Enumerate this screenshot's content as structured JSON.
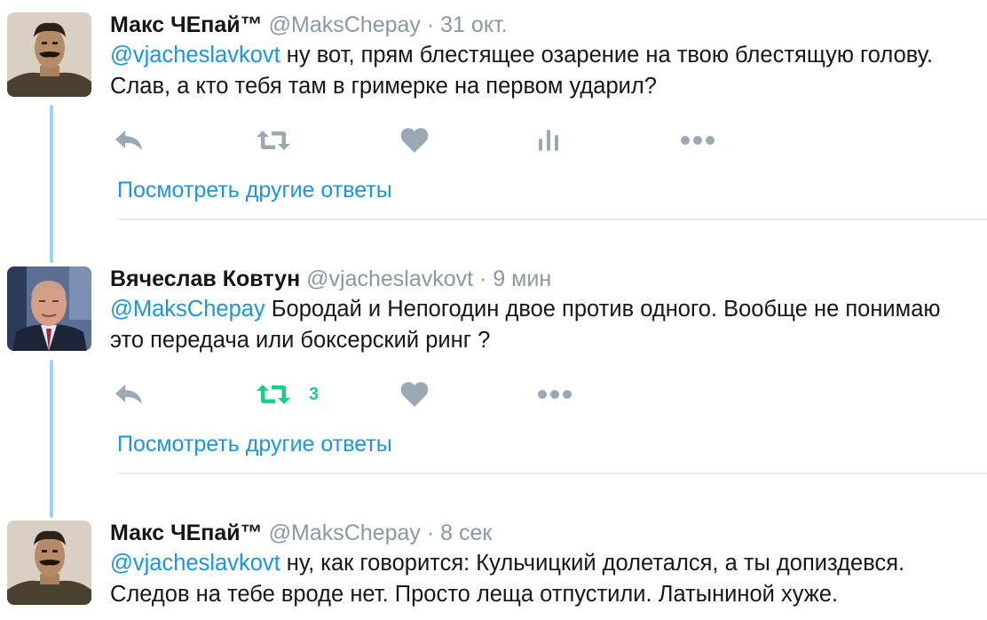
{
  "colors": {
    "link": "#1b95e0",
    "muted": "#8899a6",
    "retweeted": "#19cf86",
    "thread_line": "#9fd0f5"
  },
  "tweets": [
    {
      "name": "Макс ЧЕпай™",
      "handle": "@MaksChepay",
      "separator": "·",
      "time": "31 окт.",
      "mention": "@vjacheslavkovt",
      "text": " ну вот, прям блестящее озарение на твою блестящую голову. Слав, а кто тебя там в гримерке на первом ударил?",
      "actions": [
        "reply-icon",
        "retweet-icon",
        "like-icon",
        "analytics-icon",
        "more-icon"
      ],
      "more_replies": "Посмотреть другие ответы"
    },
    {
      "name": "Вячеслав Ковтун",
      "handle": "@vjacheslavkovt",
      "separator": "·",
      "time": "9 мин",
      "mention": "@MaksChepay",
      "text": " Бородай и Непогодин двое против одного. Вообще не понимаю это передача или боксерский ринг ?",
      "retweet_count": "3",
      "actions": [
        "reply-icon",
        "retweet-icon",
        "like-icon",
        "more-icon"
      ],
      "more_replies": "Посмотреть другие ответы"
    },
    {
      "name": "Макс ЧЕпай™",
      "handle": "@MaksChepay",
      "separator": "·",
      "time": "8 сек",
      "mention": "@vjacheslavkovt",
      "text": " ну, как говорится: Кульчицкий долетался, а ты допиздевся. Следов на тебе вроде нет. Просто леща отпустили. Латыниной хуже."
    }
  ]
}
